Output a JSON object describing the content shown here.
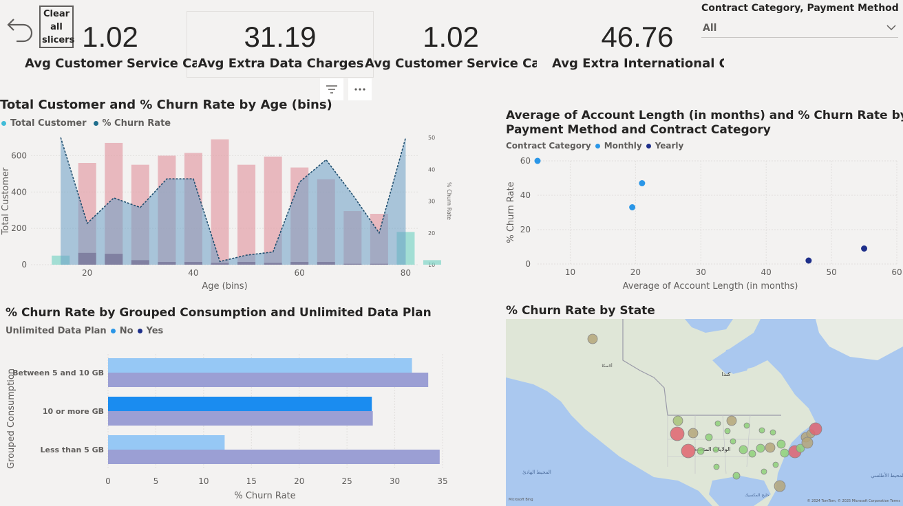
{
  "toolbar": {
    "back_icon": "back-arrow-icon",
    "clear_slicers_label": "Clear all slicers"
  },
  "kpis": [
    {
      "value": "1.02",
      "label": "Avg Customer Service Calls"
    },
    {
      "value": "31.19",
      "label": "Avg Extra Data Charges"
    },
    {
      "value": "1.02",
      "label": "Avg Customer Service Calls"
    },
    {
      "value": "46.76",
      "label": "Avg Extra International Cha"
    }
  ],
  "slicer": {
    "title": "Contract Category, Payment Method",
    "selected": "All"
  },
  "visual_header": {
    "filter_icon": "filter-icon",
    "more_icon": "more-options-icon"
  },
  "chart_data": [
    {
      "type": "bar",
      "title": "Total Customer and % Churn Rate by Age (bins)",
      "xlabel": "Age (bins)",
      "ylabel": "Total Customer",
      "y2label": "% Churn Rate",
      "legend": [
        "Total Customer",
        "% Churn Rate"
      ],
      "colors": {
        "total": "#41bcd8",
        "churn": "#1f6e8c"
      },
      "xlim": [
        12,
        85
      ],
      "ylim": [
        0,
        700
      ],
      "y2lim": [
        10,
        50
      ],
      "x_ticks": [
        20,
        40,
        60,
        80
      ],
      "y_ticks": [
        0,
        200,
        400,
        600
      ],
      "y2_ticks": [
        10,
        20,
        30,
        40,
        50
      ],
      "x": [
        15,
        20,
        25,
        30,
        35,
        40,
        45,
        50,
        55,
        60,
        65,
        70,
        75,
        80,
        85
      ],
      "total_customer": [
        50,
        560,
        670,
        550,
        600,
        615,
        690,
        550,
        595,
        535,
        470,
        295,
        280,
        180,
        25
      ],
      "churn_rate": [
        50,
        23,
        31,
        28,
        37,
        37,
        11,
        13,
        14,
        36,
        43,
        32,
        20,
        50,
        null
      ],
      "churned_count": [
        0,
        65,
        60,
        25,
        15,
        15,
        10,
        15,
        10,
        15,
        15,
        5,
        5,
        0,
        0
      ]
    },
    {
      "type": "scatter",
      "title": "Average of Account Length (in months) and % Churn Rate by Payment Method and Contract Category",
      "title_lines": [
        "Average of Account Length (in months) and % Churn Rate by",
        "Payment Method and Contract Category"
      ],
      "xlabel": "Average of Account Length (in months)",
      "ylabel": "% Churn Rate",
      "legend_title": "Contract Category",
      "legend": [
        "Monthly",
        "Yearly"
      ],
      "colors": {
        "Monthly": "#2a96e7",
        "Yearly": "#1e2f8a"
      },
      "xlim": [
        5,
        60
      ],
      "ylim": [
        0,
        60
      ],
      "x_ticks": [
        10,
        20,
        30,
        40,
        50,
        60
      ],
      "y_ticks": [
        0,
        20,
        40,
        60
      ],
      "series": [
        {
          "name": "Monthly",
          "points": [
            [
              5,
              60
            ],
            [
              21,
              47
            ],
            [
              19.5,
              33
            ]
          ]
        },
        {
          "name": "Yearly",
          "points": [
            [
              46.5,
              2
            ],
            [
              55,
              9
            ]
          ]
        }
      ]
    },
    {
      "type": "bar",
      "orientation": "horizontal",
      "title": "% Churn Rate by Grouped Consumption and Unlimited Data Plan",
      "xlabel": "% Churn Rate",
      "ylabel": "Grouped Consumption",
      "legend_title": "Unlimited Data Plan",
      "legend": [
        "No",
        "Yes"
      ],
      "colors": {
        "No": "#96c8f5",
        "Yes": "#9b9fd4",
        "highlight": "#1a8cf0"
      },
      "xlim": [
        0,
        35
      ],
      "x_ticks": [
        0,
        5,
        10,
        15,
        20,
        25,
        30,
        35
      ],
      "categories": [
        "Between 5 and 10 GB",
        "10 or more GB",
        "Less than 5 GB"
      ],
      "series": [
        {
          "name": "No",
          "values": [
            31.8,
            27.6,
            12.2
          ]
        },
        {
          "name": "Yes",
          "values": [
            33.5,
            27.7,
            34.7
          ]
        }
      ]
    }
  ],
  "map": {
    "title": "% Churn Rate by State",
    "labels": {
      "canada": "كندا",
      "usa": "الولايات المتحدة",
      "alaska": "ألاسكا",
      "pacific": "المحيط الهادئ",
      "atlantic": "المحيط الأطلسي",
      "gulf": "خليج المكسيك"
    },
    "attribution_left": "Microsoft Bing",
    "attribution_right": "© 2024 TomTom, © 2025 Microsoft Corporation Terms"
  }
}
